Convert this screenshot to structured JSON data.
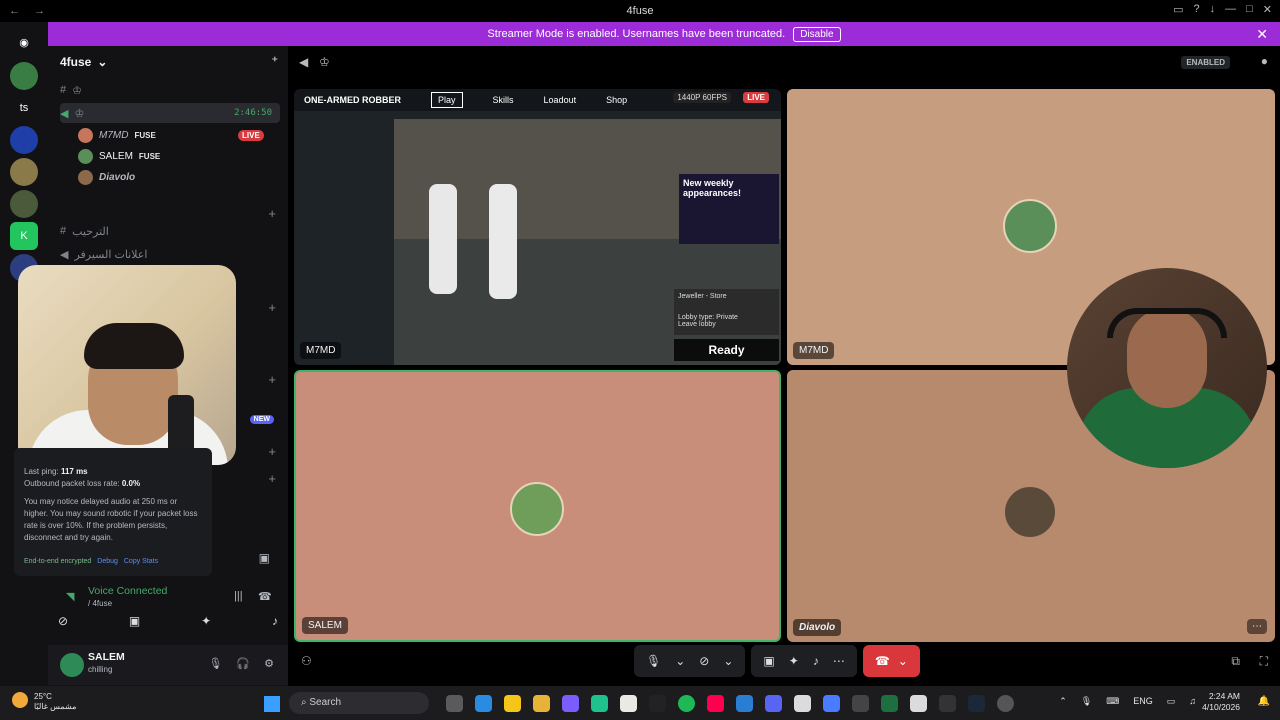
{
  "window": {
    "title": "4fuse"
  },
  "banner": {
    "text": "Streamer Mode is enabled. Usernames have been truncated.",
    "disable_label": "Disable"
  },
  "guild": {
    "name": "4fuse",
    "rail_label": "ts"
  },
  "sidebar": {
    "voice_channel_timer": "2:46:50",
    "users": [
      {
        "name": "M7MD",
        "tag": "FUSE",
        "live": "LIVE"
      },
      {
        "name": "SALEM",
        "tag": "FUSE"
      },
      {
        "name": "Diavolo"
      }
    ],
    "ch_welcome": "الترحيب",
    "ch_announce": "اعلانات السيرفر",
    "new_badge": "NEW"
  },
  "popup": {
    "line1_label": "Last ping:",
    "line1_value": "117 ms",
    "line2_label": "Outbound packet loss rate:",
    "line2_value": "0.0%",
    "body": "You may notice delayed audio at 250 ms or higher. You may sound robotic if your packet loss rate is over 10%. If the problem persists, disconnect and try again.",
    "foot": "End-to-end encrypted",
    "debug": "Debug",
    "copy": "Copy Stats"
  },
  "voice": {
    "status": "Voice Connected",
    "channel": "/ 4fuse"
  },
  "user": {
    "name": "SALEM",
    "status": "chilling"
  },
  "stage": {
    "enabled_badge": "ENABLED"
  },
  "tiles": [
    {
      "label": "M7MD"
    },
    {
      "label": "M7MD"
    },
    {
      "label": "SALEM"
    },
    {
      "label": "Diavolo"
    }
  ],
  "game": {
    "title": "ONE-ARMED ROBBER",
    "menu": [
      "Play",
      "Skills",
      "Loadout",
      "Shop"
    ],
    "quality": "1440P 60FPS",
    "live": "LIVE",
    "ad": "New weekly appearances!",
    "ready": "Ready",
    "lobby": "Lobby type: Private",
    "leave": "Leave lobby",
    "store": "Jeweller - Store"
  },
  "taskbar": {
    "temp": "25°C",
    "weather": "مشمس غالبًا",
    "search": "Search",
    "lang": "ENG",
    "time": "2:24 AM",
    "date": "4/10/2026"
  }
}
